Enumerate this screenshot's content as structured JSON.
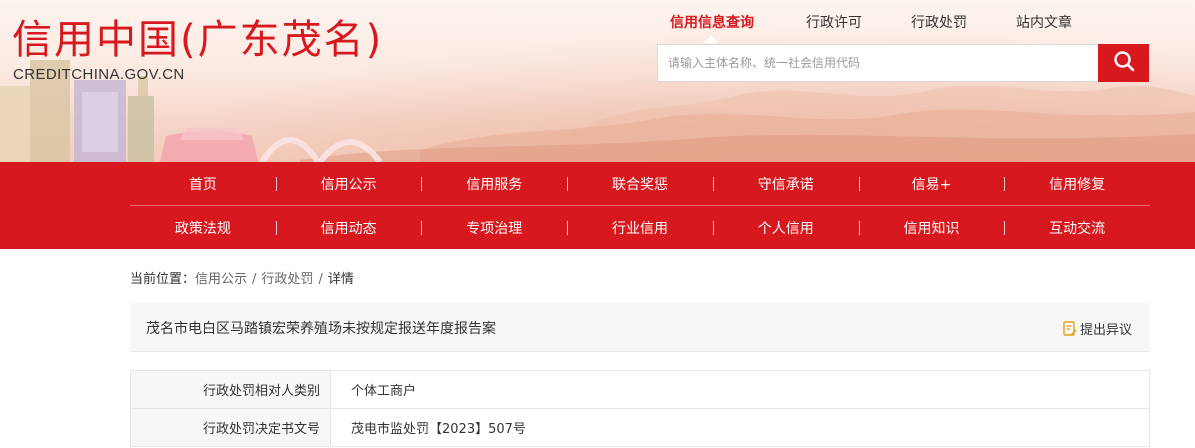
{
  "header": {
    "site_title": "信用中国(广东茂名)",
    "site_url": "CREDITCHINA.GOV.CN",
    "top_nav": [
      {
        "label": "信用信息查询",
        "active": true
      },
      {
        "label": "行政许可",
        "active": false
      },
      {
        "label": "行政处罚",
        "active": false
      },
      {
        "label": "站内文章",
        "active": false
      }
    ],
    "search": {
      "placeholder": "请输入主体名称、统一社会信用代码",
      "value": "",
      "button_icon": "search-icon"
    }
  },
  "main_nav": {
    "row1": [
      "首页",
      "信用公示",
      "信用服务",
      "联合奖惩",
      "守信承诺",
      "信易+",
      "信用修复"
    ],
    "row2": [
      "政策法规",
      "信用动态",
      "专项治理",
      "行业信用",
      "个人信用",
      "信用知识",
      "互动交流"
    ]
  },
  "breadcrumb": {
    "prefix": "当前位置：",
    "items": [
      "信用公示",
      "行政处罚",
      "详情"
    ],
    "separator": "/"
  },
  "detail": {
    "title": "茂名市电白区马踏镇宏荣养殖场未按规定报送年度报告案",
    "objection_label": "提出异议",
    "objection_icon": "report-edit-icon",
    "rows": [
      {
        "label": "行政处罚相对人类别",
        "value": "个体工商户"
      },
      {
        "label": "行政处罚决定书文号",
        "value": "茂电市监处罚【2023】507号"
      }
    ]
  },
  "colors": {
    "brand_red": "#d7191f",
    "panel_gray": "#f7f7f7"
  }
}
